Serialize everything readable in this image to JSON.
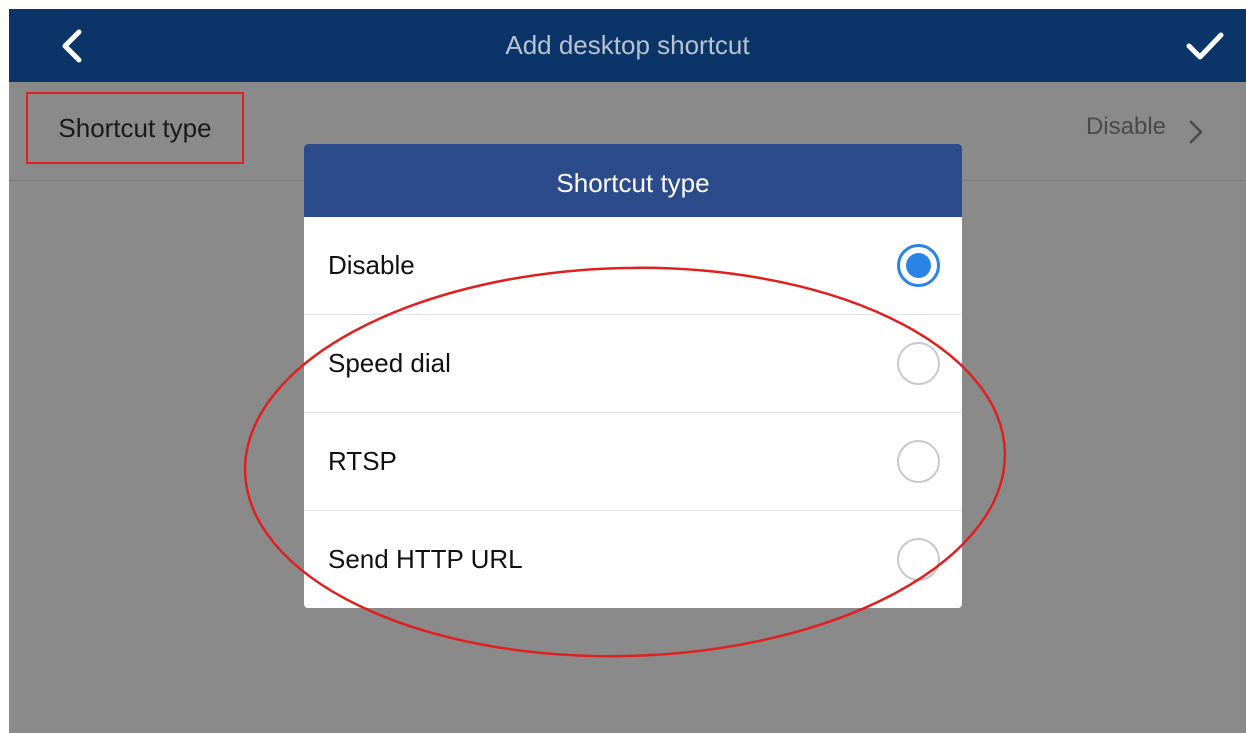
{
  "appbar": {
    "title": "Add desktop shortcut",
    "back_icon": "chevron-left-icon",
    "confirm_icon": "checkmark-icon",
    "background": "#0b3468"
  },
  "settings_row": {
    "label": "Shortcut type",
    "value": "Disable",
    "chevron_icon": "chevron-right-icon"
  },
  "dialog": {
    "title": "Shortcut type",
    "header_color": "#2c4b8b",
    "options": [
      {
        "label": "Disable",
        "selected": true
      },
      {
        "label": "Speed dial",
        "selected": false
      },
      {
        "label": "RTSP",
        "selected": false
      },
      {
        "label": "Send HTTP URL",
        "selected": false
      }
    ]
  },
  "colors": {
    "accent": "#2a84e6",
    "annotation": "#e02020",
    "overlay": "#8a8a8a"
  }
}
